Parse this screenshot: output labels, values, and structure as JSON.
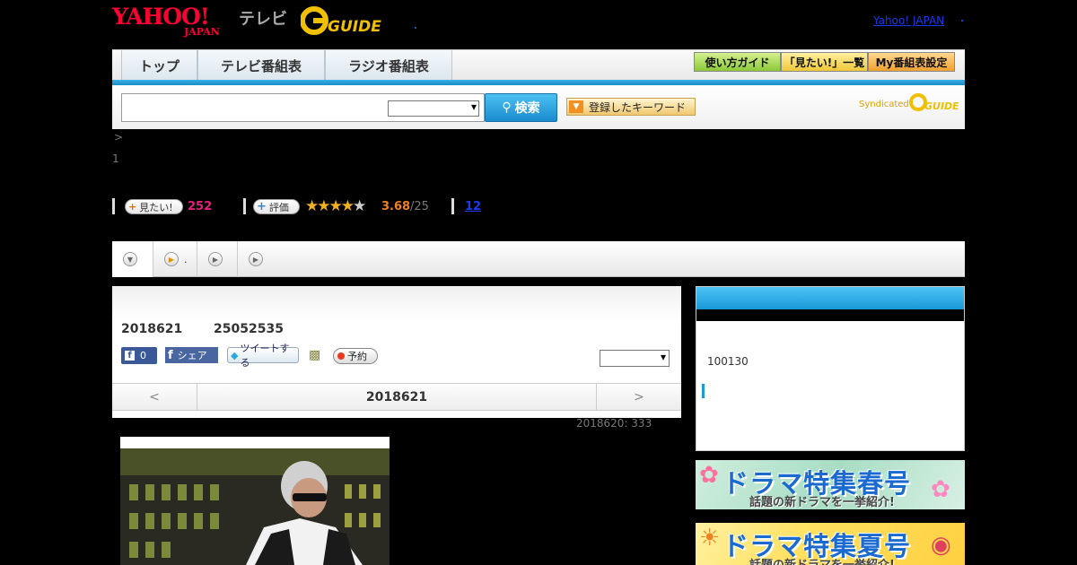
{
  "header": {
    "logo_yahoo": "YAHOO!",
    "logo_japan": "JAPAN",
    "logo_tv": "テレビ",
    "logo_gguide": "G GUIDE",
    "yahoo_japan_link": "Yahoo! JAPAN"
  },
  "nav": {
    "tabs": [
      {
        "label": "トップ"
      },
      {
        "label": "テレビ番組表"
      },
      {
        "label": "ラジオ番組表"
      }
    ],
    "guide_buttons": [
      {
        "label": "使い方ガイド",
        "color": "#a8d848"
      },
      {
        "label": "「見たい!」一覧",
        "color": "#f8d048"
      },
      {
        "label": "My番組表設定",
        "color": "#f8b048"
      }
    ]
  },
  "search": {
    "input_value": "",
    "select_value": "",
    "search_button": "検索",
    "keyword_button": "登録したキーワード",
    "syndicated": "Syndicated"
  },
  "breadcrumb": ">",
  "page_counter": "1",
  "stats": {
    "mitai_label": "見たい!",
    "mitai_count": "252",
    "rate_label": "評価",
    "rating": "3.68",
    "rating_max": "/25",
    "rating_fraction": 0.736,
    "reviews": "12"
  },
  "subtabs": [
    {
      "label": ""
    },
    {
      "label": "."
    },
    {
      "label": ""
    },
    {
      "label": ""
    }
  ],
  "program": {
    "date": "2018621",
    "time": "25052535",
    "fb_like_count": "0",
    "fb_share": "シェア",
    "tweet": "ツイートする",
    "reserve": "予約",
    "select_value": "",
    "prev": "<",
    "current_day": "2018621",
    "next": ">",
    "broadcast_note": "2018620: 333"
  },
  "sidebar": {
    "text": "100130"
  },
  "banners": [
    {
      "title": "ドラマ特集春号",
      "subtitle": "話題の新ドラマを一挙紹介!"
    },
    {
      "title": "ドラマ特集夏号",
      "subtitle": "話題の新ドラマを一挙紹介!"
    }
  ]
}
